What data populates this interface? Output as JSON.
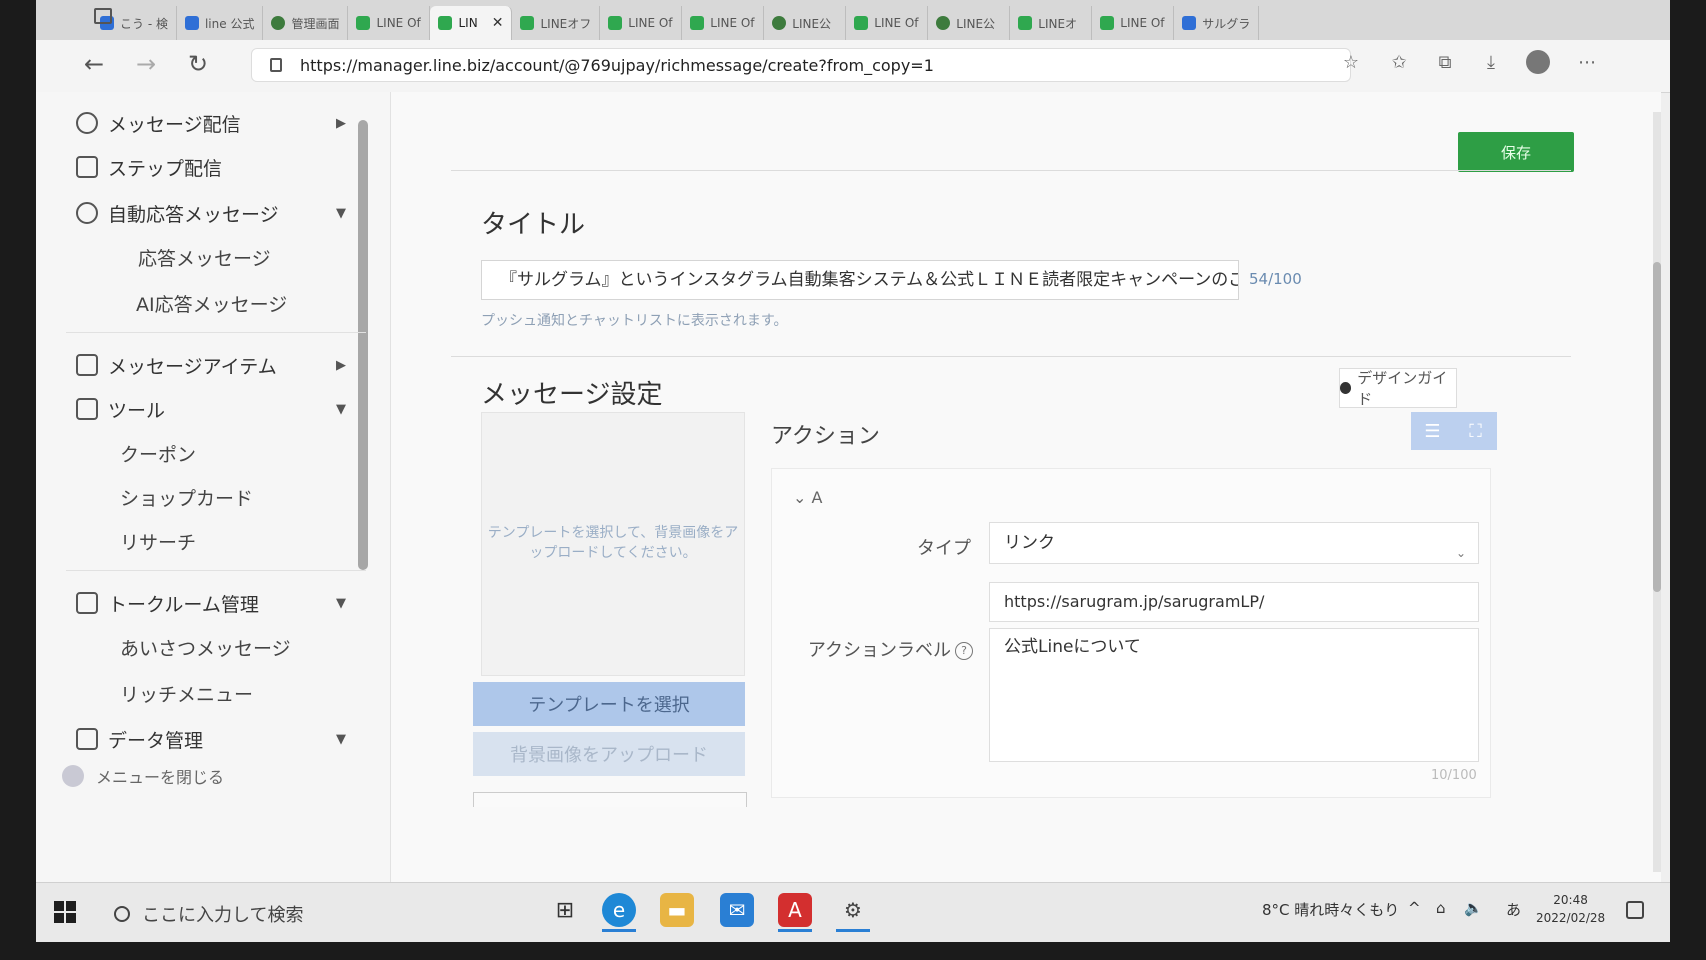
{
  "browser": {
    "tabs": [
      {
        "label": "こう - 検",
        "icon": "blue"
      },
      {
        "label": "line 公式",
        "icon": "blue"
      },
      {
        "label": "管理画面",
        "icon": "chat"
      },
      {
        "label": "LINE Of",
        "icon": "green"
      },
      {
        "label": "LIN",
        "icon": "green",
        "active": true
      },
      {
        "label": "LINEオフ",
        "icon": "green"
      },
      {
        "label": "LINE Of",
        "icon": "green"
      },
      {
        "label": "LINE Of",
        "icon": "green"
      },
      {
        "label": "LINE公",
        "icon": "chat"
      },
      {
        "label": "LINE Of",
        "icon": "green"
      },
      {
        "label": "LINE公",
        "icon": "chat"
      },
      {
        "label": "LINEオ",
        "icon": "green"
      },
      {
        "label": "LINE Of",
        "icon": "green"
      },
      {
        "label": "サルグラ",
        "icon": "blue"
      }
    ],
    "url": "https://manager.line.biz/account/@769ujpay/richmessage/create?from_copy=1"
  },
  "sidebar": {
    "items": [
      {
        "label": "メッセージ配信",
        "icon": "broadcast-icon",
        "arrow": "▶"
      },
      {
        "label": "ステップ配信",
        "icon": "step-icon"
      },
      {
        "label": "自動応答メッセージ",
        "icon": "auto-reply-icon",
        "arrow": "▼"
      },
      {
        "label": "応答メッセージ",
        "sub": true
      },
      {
        "label": "AI応答メッセージ",
        "sub": true
      },
      {
        "label": "メッセージアイテム",
        "icon": "message-item-icon",
        "arrow": "▶"
      },
      {
        "label": "ツール",
        "icon": "tool-icon",
        "arrow": "▼"
      },
      {
        "label": "クーポン",
        "sub": true
      },
      {
        "label": "ショップカード",
        "sub": true
      },
      {
        "label": "リサーチ",
        "sub": true
      },
      {
        "label": "トークルーム管理",
        "icon": "talkroom-icon",
        "arrow": "▼"
      },
      {
        "label": "あいさつメッセージ",
        "sub": true
      },
      {
        "label": "リッチメニュー",
        "sub": true
      },
      {
        "label": "データ管理",
        "icon": "database-icon",
        "arrow": "▼"
      }
    ],
    "close_menu": "メニューを閉じる"
  },
  "main": {
    "save_label": "保存",
    "title_heading": "タイトル",
    "title_value": "『サルグラム』というインスタグラム自動集客システム＆公式ＬＩＮＥ読者限定キャンペーンのご紹介を",
    "title_counter": "54/100",
    "title_hint": "プッシュ通知とチャットリストに表示されます。",
    "message_heading": "メッセージ設定",
    "design_guide_label": "デザインガイド",
    "preview_text": "テンプレートを選択して、背景画像をアップロードしてください。",
    "select_template_label": "テンプレートを選択",
    "upload_bg_label": "背景画像をアップロード",
    "action_heading": "アクション",
    "action": {
      "name": "A",
      "type_label": "タイプ",
      "type_value": "リンク",
      "url_value": "https://sarugram.jp/sarugramLP/",
      "label_label": "アクションラベル",
      "label_value": "公式Lineについて",
      "label_counter": "10/100"
    }
  },
  "taskbar": {
    "search_placeholder": "ここに入力して検索",
    "weather": "8°C 晴れ時々くもり",
    "ime": "あ",
    "time": "20:48",
    "date": "2022/02/28"
  },
  "colors": {
    "save_green": "#2e9e45",
    "primary_button": "#aec7ea",
    "link_blue": "#6a8bb0"
  }
}
